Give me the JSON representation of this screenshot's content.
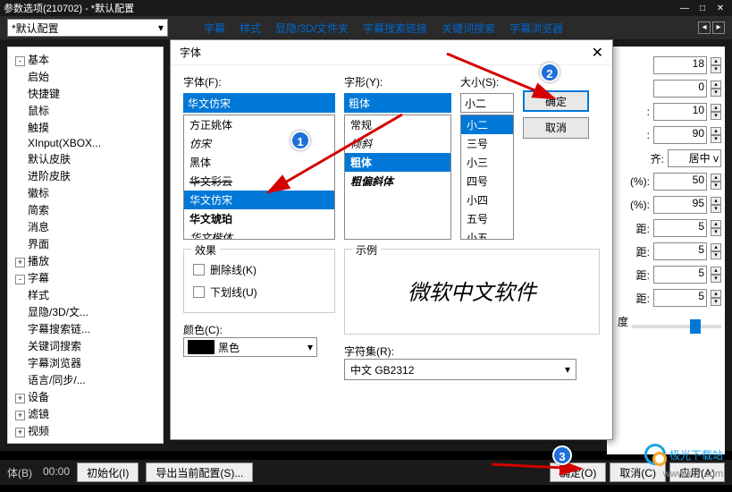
{
  "titlebar": {
    "title": "参数选项(210702) - *默认配置"
  },
  "config_combo": {
    "value": "*默认配置"
  },
  "tabs": [
    "字幕",
    "样式",
    "显隐/3D/文件夹",
    "字幕搜索链接",
    "关键词搜索",
    "字幕浏览器"
  ],
  "tree": [
    {
      "lvl": 1,
      "exp": "-",
      "label": "基本"
    },
    {
      "lvl": 2,
      "label": "启始"
    },
    {
      "lvl": 2,
      "label": "快捷键"
    },
    {
      "lvl": 2,
      "label": "鼠标"
    },
    {
      "lvl": 2,
      "label": "触摸"
    },
    {
      "lvl": 2,
      "label": "XInput(XBOX..."
    },
    {
      "lvl": 2,
      "label": "默认皮肤"
    },
    {
      "lvl": 2,
      "label": "进阶皮肤"
    },
    {
      "lvl": 2,
      "label": "徽标"
    },
    {
      "lvl": 2,
      "label": "简索"
    },
    {
      "lvl": 2,
      "label": "消息"
    },
    {
      "lvl": 2,
      "label": "界面"
    },
    {
      "lvl": 1,
      "exp": "+",
      "label": "播放"
    },
    {
      "lvl": 1,
      "exp": "-",
      "label": "字幕"
    },
    {
      "lvl": 2,
      "label": "样式"
    },
    {
      "lvl": 2,
      "label": "显隐/3D/文..."
    },
    {
      "lvl": 2,
      "label": "字幕搜索链..."
    },
    {
      "lvl": 2,
      "label": "关键词搜索"
    },
    {
      "lvl": 2,
      "label": "字幕浏览器"
    },
    {
      "lvl": 2,
      "label": "语言/同步/..."
    },
    {
      "lvl": 1,
      "exp": "+",
      "label": "设备"
    },
    {
      "lvl": 1,
      "exp": "+",
      "label": "滤镜"
    },
    {
      "lvl": 1,
      "exp": "+",
      "label": "视频"
    }
  ],
  "props": [
    {
      "label": "",
      "value": "18"
    },
    {
      "label": "",
      "value": "0"
    },
    {
      "label": ":",
      "value": "10"
    },
    {
      "label": ":",
      "value": "90"
    },
    {
      "label": "齐:",
      "value": "居中",
      "select": true,
      "unit": ""
    },
    {
      "label": "(%):",
      "value": "50"
    },
    {
      "label": "(%):",
      "value": "95"
    },
    {
      "label": "距:",
      "value": "5"
    },
    {
      "label": "距:",
      "value": "5"
    },
    {
      "label": "距:",
      "value": "5"
    },
    {
      "label": "距:",
      "value": "5"
    },
    {
      "label": "度",
      "value": "",
      "slider": true
    }
  ],
  "bottombar": {
    "left1": "体(B)",
    "left2": "00:00",
    "btn_init": "初始化(I)",
    "btn_export": "导出当前配置(S)...",
    "btn_ok": "确定(O)",
    "btn_cancel": "取消(C)",
    "btn_apply": "应用(A)"
  },
  "dialog": {
    "title": "字体",
    "font_label": "字体(F):",
    "style_label": "字形(Y):",
    "size_label": "大小(S):",
    "font_value": "华文仿宋",
    "style_value": "粗体",
    "size_value": "小二",
    "fonts": [
      {
        "t": "方正姚体"
      },
      {
        "t": "仿宋",
        "italic": true
      },
      {
        "t": "黑体"
      },
      {
        "t": "华文彩云",
        "strike": true
      },
      {
        "t": "华文仿宋",
        "sel": true
      },
      {
        "t": "华文琥珀",
        "bold": true
      },
      {
        "t": "华文楷体",
        "italic": true
      }
    ],
    "styles": [
      {
        "t": "常规"
      },
      {
        "t": "倾斜",
        "italic": true
      },
      {
        "t": "粗体",
        "sel": true,
        "bold": true
      },
      {
        "t": "粗偏斜体",
        "bold": true,
        "italic": true
      }
    ],
    "sizes": [
      {
        "t": "小二",
        "sel": true
      },
      {
        "t": "三号"
      },
      {
        "t": "小三"
      },
      {
        "t": "四号"
      },
      {
        "t": "小四"
      },
      {
        "t": "五号"
      },
      {
        "t": "小五"
      }
    ],
    "btn_ok": "确定",
    "btn_cancel": "取消",
    "effects_title": "效果",
    "strike_label": "删除线(K)",
    "underline_label": "下划线(U)",
    "color_label": "颜色(C):",
    "color_value": "黑色",
    "sample_title": "示例",
    "sample_text": "微软中文软件",
    "charset_label": "字符集(R):",
    "charset_value": "中文 GB2312"
  },
  "annotations": {
    "n1": "1",
    "n2": "2",
    "n3": "3"
  },
  "watermark": {
    "brand": "极光下载站",
    "url": "www.xz7.com"
  }
}
